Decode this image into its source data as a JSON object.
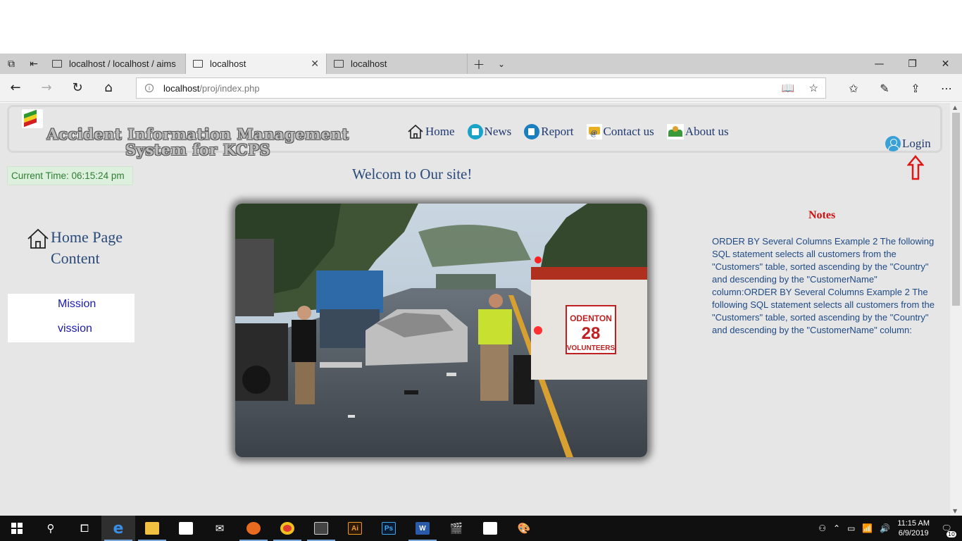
{
  "browser": {
    "tabs": [
      {
        "title": "localhost / localhost / aims",
        "active": false
      },
      {
        "title": "localhost",
        "active": true
      },
      {
        "title": "localhost",
        "active": false
      }
    ],
    "url_host": "localhost",
    "url_path": "/proj/index.php"
  },
  "site": {
    "title_line1": "Accident Information Management",
    "title_line2": "System for KCPS",
    "nav": [
      {
        "label": "Home"
      },
      {
        "label": "News"
      },
      {
        "label": "Report"
      },
      {
        "label": "Contact us"
      },
      {
        "label": "About us"
      }
    ],
    "login_label": "Login",
    "current_time": "Current Time: 06:15:24 pm",
    "welcome": "Welcom to Our site!",
    "home_content_line1": "Home Page",
    "home_content_line2": "Content",
    "links": [
      {
        "label": "Mission"
      },
      {
        "label": "vission"
      }
    ],
    "photo_labels": {
      "engine_line1": "ODENTON",
      "engine_line2": "28",
      "engine_line3": "VOLUNTEERS"
    },
    "notes_title": "Notes",
    "notes_body": "ORDER BY Several Columns Example 2 The following SQL statement selects all customers from the \"Customers\" table, sorted ascending by the \"Country\" and descending by the \"CustomerName\" column:ORDER BY Several Columns Example 2 The following SQL statement selects all customers from the \"Customers\" table, sorted ascending by the \"Country\" and descending by the \"CustomerName\" column:"
  },
  "taskbar": {
    "time": "11:15 AM",
    "date": "6/9/2019",
    "notifications": "10",
    "app_ai": "Ai",
    "app_ps": "Ps"
  },
  "colors": {
    "accent_nav": "#203a70",
    "notes_title": "#cc1111",
    "clock_text": "#2e7d32",
    "link": "#1a1ab0"
  }
}
